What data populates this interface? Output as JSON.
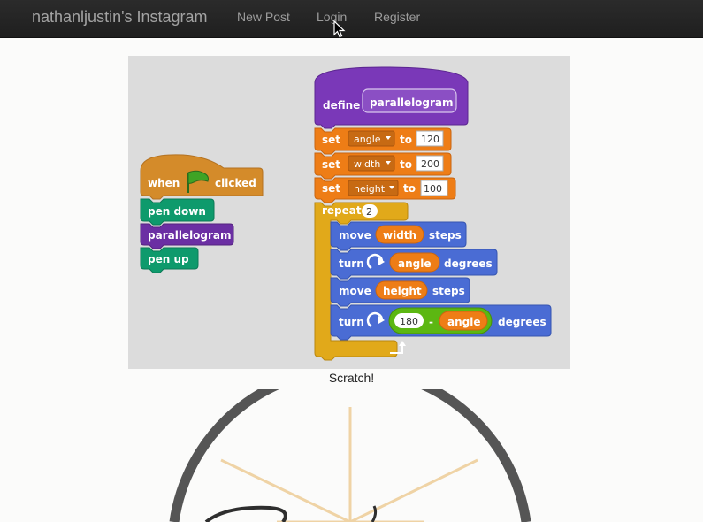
{
  "navbar": {
    "brand": "nathanljustin's Instagram",
    "links": [
      "New Post",
      "Login",
      "Register"
    ]
  },
  "post": {
    "caption": "Scratch!",
    "scratch": {
      "define": "define",
      "proc_name": "parallelogram",
      "set": "set",
      "to": "to",
      "vars": [
        {
          "name": "angle",
          "value": "120"
        },
        {
          "name": "width",
          "value": "200"
        },
        {
          "name": "height",
          "value": "100"
        }
      ],
      "repeat": "repeat",
      "repeat_count": "2",
      "move": "move",
      "steps": "steps",
      "turn": "turn",
      "degrees": "degrees",
      "when": "when",
      "clicked": "clicked",
      "pen_down": "pen down",
      "pen_up": "pen up",
      "subtract_left": "180",
      "minus": "-"
    }
  },
  "colors": {
    "event": "#d48b2a",
    "pen": "#0e9a6c",
    "custom": "#6b2fa3",
    "variables": "#ee7d16",
    "control": "#e1a91a",
    "motion": "#4a6cd4",
    "operators": "#5cb712"
  },
  "icons": [
    "green-flag-icon",
    "turn-right-icon",
    "dropdown-arrow-icon",
    "loop-arrow-icon",
    "mouse-cursor-icon"
  ]
}
